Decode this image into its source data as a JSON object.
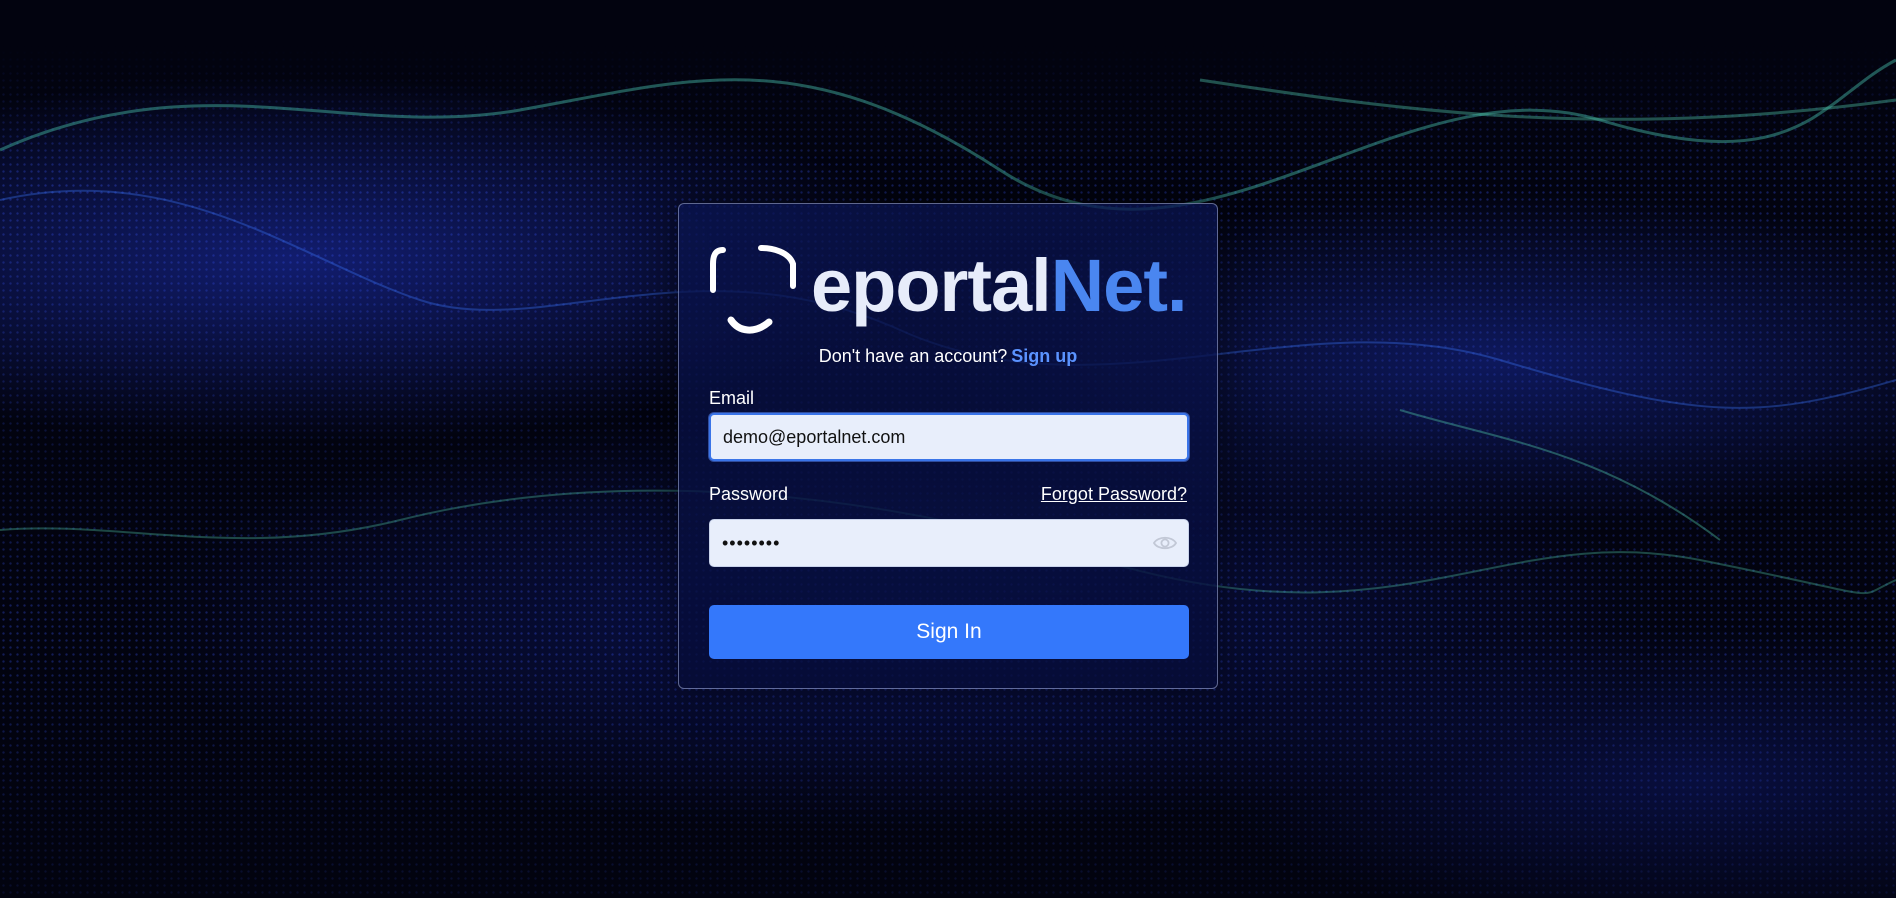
{
  "brand": {
    "logo_part1": "eportal",
    "logo_part2": "Net.",
    "accent_color": "#4a86f0"
  },
  "signup": {
    "prompt": "Don't have an account?",
    "link_label": "Sign up"
  },
  "form": {
    "email_label": "Email",
    "email_value": "demo@eportalnet.com",
    "password_label": "Password",
    "forgot_label": "Forgot Password?",
    "password_mask": "••••••••",
    "show_password_icon": "eye-icon",
    "submit_label": "Sign In",
    "submit_color": "#3478fb"
  }
}
